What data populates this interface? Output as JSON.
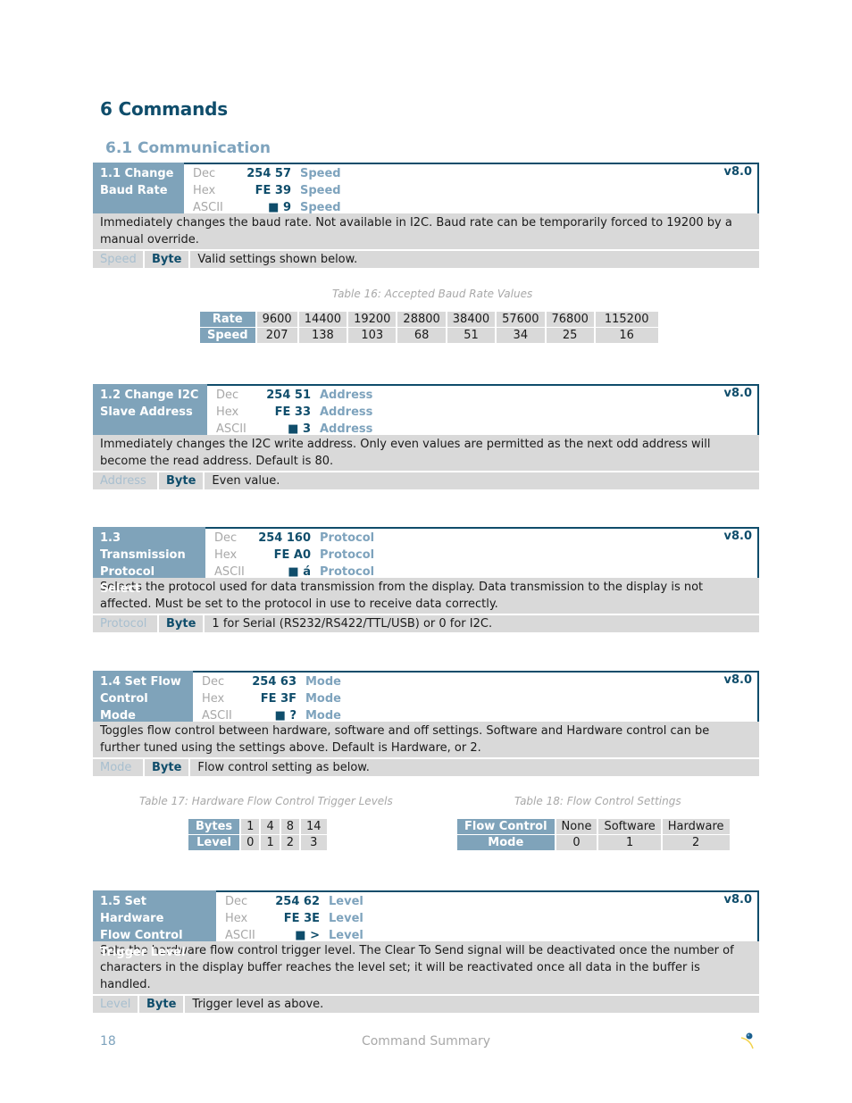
{
  "heading": "6 Commands",
  "subheading": "6.1 Communication",
  "commands": [
    {
      "name_lines": [
        "1.1 Change",
        "Baud Rate"
      ],
      "dec": "254 57",
      "hex": "FE 39",
      "ascii": "■ 9",
      "param": "Speed",
      "version": "v8.0",
      "description": "Immediately changes the baud rate.  Not available in I2C.  Baud rate can be temporarily forced to 19200 by a manual override.",
      "param_row": {
        "name": "Speed",
        "type": "Byte",
        "desc": "Valid settings shown below."
      }
    },
    {
      "name_lines": [
        "1.2 Change I2C",
        "Slave Address"
      ],
      "dec": "254 51",
      "hex": "FE 33",
      "ascii": "■ 3",
      "param": "Address",
      "version": "v8.0",
      "description": "Immediately changes the I2C write address.  Only even values are permitted as the next odd address will become the read address.  Default is 80.",
      "param_row": {
        "name": "Address",
        "type": "Byte",
        "desc": "Even value."
      }
    },
    {
      "name_lines": [
        "1.3 Transmission",
        "Protocol Select"
      ],
      "dec": "254 160",
      "hex": "FE A0",
      "ascii": "■ á",
      "param": "Protocol",
      "version": "v8.0",
      "description": "Selects the protocol used for data transmission from the display.  Data transmission to the display is not affected.  Must be set to the protocol in use to receive data correctly.",
      "param_row": {
        "name": "Protocol",
        "type": "Byte",
        "desc": "1 for Serial (RS232/RS422/TTL/USB) or 0 for I2C."
      }
    },
    {
      "name_lines": [
        "1.4 Set Flow",
        "Control Mode"
      ],
      "dec": "254 63",
      "hex": "FE 3F",
      "ascii": "■ ?",
      "param": "Mode",
      "version": "v8.0",
      "description": "Toggles flow control between hardware, software and off settings.  Software and Hardware control can be further tuned using the settings above.  Default is Hardware, or 2.",
      "param_row": {
        "name": "Mode",
        "type": "Byte",
        "desc": "Flow control setting as below."
      }
    },
    {
      "name_lines": [
        "1.5 Set Hardware",
        "Flow Control",
        "Trigger Level"
      ],
      "dec": "254 62",
      "hex": "FE 3E",
      "ascii": "■ >",
      "param": "Level",
      "version": "v8.0",
      "description": "Sets the hardware flow control trigger level.  The Clear To Send signal will be deactivated once the number of characters in the display buffer reaches the level set; it will be reactivated once all data in the buffer is handled.",
      "param_row": {
        "name": "Level",
        "type": "Byte",
        "desc": "Trigger level as above."
      }
    }
  ],
  "code_labels": {
    "dec": "Dec",
    "hex": "Hex",
    "ascii": "ASCII"
  },
  "table16": {
    "caption": "Table 16: Accepted Baud Rate Values",
    "row_headers": [
      "Rate",
      "Speed"
    ],
    "rate": [
      "9600",
      "14400",
      "19200",
      "28800",
      "38400",
      "57600",
      "76800",
      "115200"
    ],
    "speed": [
      "207",
      "138",
      "103",
      "68",
      "51",
      "34",
      "25",
      "16"
    ]
  },
  "table17": {
    "caption": "Table 17: Hardware Flow Control Trigger Levels",
    "row_headers": [
      "Bytes",
      "Level"
    ],
    "bytes": [
      "1",
      "4",
      "8",
      "14"
    ],
    "level": [
      "0",
      "1",
      "2",
      "3"
    ]
  },
  "table18": {
    "caption": "Table 18: Flow Control Settings",
    "row_headers": [
      "Flow Control",
      "Mode"
    ],
    "flow_control": [
      "None",
      "Software",
      "Hardware"
    ],
    "mode": [
      "0",
      "1",
      "2"
    ]
  },
  "footer": {
    "page_number": "18",
    "title": "Command Summary",
    "logo_icon": "company-logo-icon"
  }
}
